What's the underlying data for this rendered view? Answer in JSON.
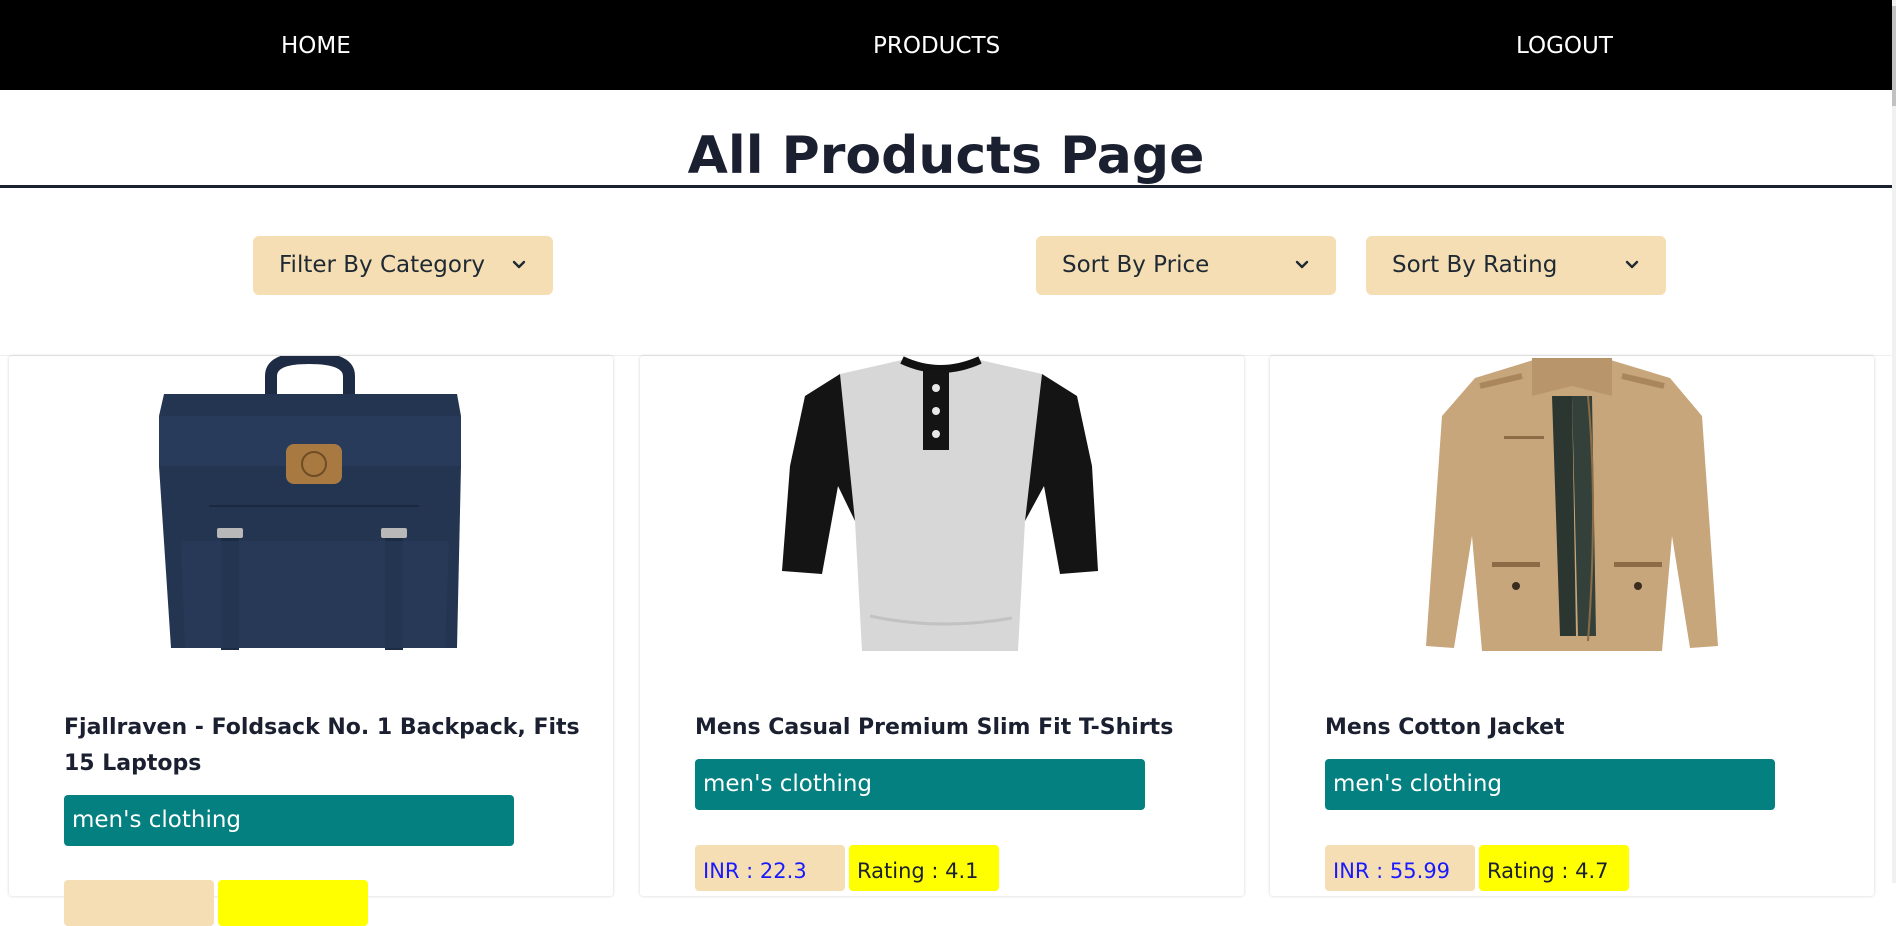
{
  "nav": {
    "home": "HOME",
    "products": "PRODUCTS",
    "logout": "LOGOUT"
  },
  "page": {
    "title": "All Products Page"
  },
  "filters": {
    "category": "Filter By Category",
    "price": "Sort By Price",
    "rating": "Sort By Rating"
  },
  "products": [
    {
      "title": "Fjallraven - Foldsack No. 1 Backpack, Fits 15 Laptops",
      "category": "men's clothing",
      "price": "",
      "rating": "",
      "image_icon": "backpack-image"
    },
    {
      "title": "Mens Casual Premium Slim Fit T-Shirts",
      "category": "men's clothing",
      "price": "INR : 22.3",
      "rating": "Rating : 4.1",
      "image_icon": "tshirt-image"
    },
    {
      "title": "Mens Cotton Jacket",
      "category": "men's clothing",
      "price": "INR : 55.99",
      "rating": "Rating : 4.7",
      "image_icon": "jacket-image"
    }
  ],
  "colors": {
    "navbar": "#000000",
    "dropdown": "#f5deb3",
    "category_badge": "#048080",
    "price_badge": "#f5deb3",
    "price_text": "#1a1aff",
    "rating_badge": "#ffff00"
  }
}
